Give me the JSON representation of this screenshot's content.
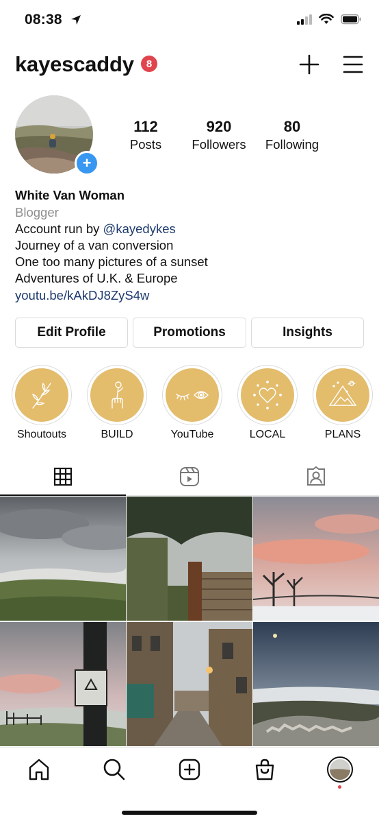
{
  "status_bar": {
    "time": "08:38"
  },
  "header": {
    "username": "kayescaddy",
    "notification_count": "8"
  },
  "stats": [
    {
      "value": "112",
      "label": "Posts"
    },
    {
      "value": "920",
      "label": "Followers"
    },
    {
      "value": "80",
      "label": "Following"
    }
  ],
  "bio": {
    "name": "White Van Woman",
    "category": "Blogger",
    "line1_prefix": "Account run by ",
    "line1_mention": "@kayedykes",
    "line2": "Journey of a van conversion",
    "line3": "One too many pictures of a sunset",
    "line4": "Adventures of U.K. & Europe",
    "link": "youtu.be/kAkDJ8ZyS4w"
  },
  "buttons": {
    "edit": "Edit Profile",
    "promotions": "Promotions",
    "insights": "Insights"
  },
  "highlights": [
    {
      "label": "Shoutouts",
      "icon": "leaf-branch-icon"
    },
    {
      "label": "BUILD",
      "icon": "hand-flower-icon"
    },
    {
      "label": "YouTube",
      "icon": "eyes-icon"
    },
    {
      "label": "LOCAL",
      "icon": "heart-icon"
    },
    {
      "label": "PLANS",
      "icon": "mountain-icon"
    }
  ],
  "tabs": [
    {
      "name": "grid-icon",
      "active": true
    },
    {
      "name": "reels-icon",
      "active": false
    },
    {
      "name": "tagged-icon",
      "active": false
    }
  ],
  "bottom_nav": [
    "home-icon",
    "search-icon",
    "create-icon",
    "shop-icon",
    "profile-avatar"
  ],
  "colors": {
    "accent_blue": "#3897f0",
    "badge_red": "#e0454d",
    "highlight_gold": "#e3bc6c",
    "link_blue": "#1d3a6d"
  }
}
